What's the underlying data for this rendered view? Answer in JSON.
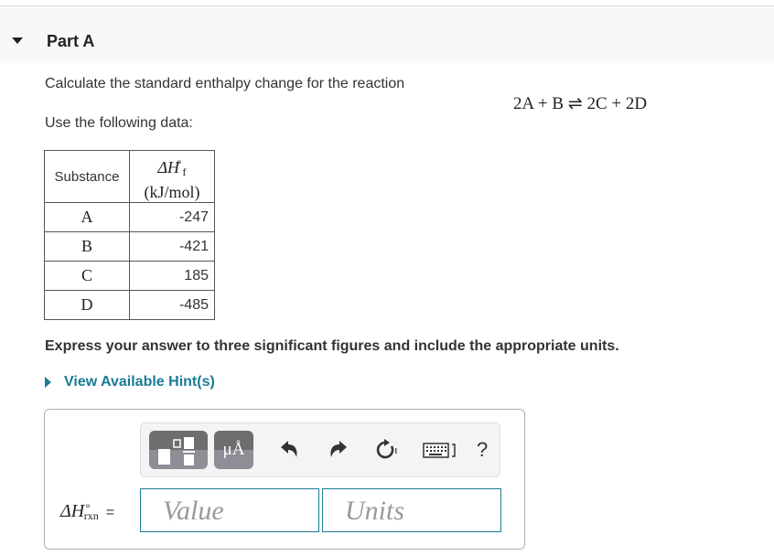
{
  "part": {
    "title": "Part A",
    "collapse_icon": "caret-down-icon"
  },
  "question": {
    "line1": "Calculate the standard enthalpy change for the reaction",
    "reaction": "2A + B ⇌ 2C + 2D",
    "line2": "Use the following data:"
  },
  "table": {
    "headers": {
      "substance": "Substance",
      "enthalpy_symbol": "ΔH",
      "enthalpy_subscript": "f",
      "enthalpy_superscript": "∘",
      "enthalpy_units": "(kJ/mol)"
    },
    "rows": [
      {
        "substance": "A",
        "value": "-247"
      },
      {
        "substance": "B",
        "value": "-421"
      },
      {
        "substance": "C",
        "value": "185"
      },
      {
        "substance": "D",
        "value": "-485"
      }
    ]
  },
  "instructions": "Express your answer to three significant figures and include the appropriate units.",
  "hint_link": "View Available Hint(s)",
  "toolbar": {
    "templates_icon": "templates-icon",
    "symbols_label": "μÅ",
    "undo_icon": "undo-icon",
    "redo_icon": "redo-icon",
    "reset_icon": "reset-icon",
    "keyboard_icon": "keyboard-icon",
    "help_label": "?"
  },
  "answer": {
    "lhs_symbol": "ΔH",
    "lhs_superscript": "∘",
    "lhs_subscript": "rxn",
    "equals": "=",
    "value_placeholder": "Value",
    "units_placeholder": "Units",
    "value": "",
    "units": ""
  },
  "colors": {
    "accent": "#1a7b96",
    "header_bg": "#f8f8f8",
    "text": "#333333"
  }
}
